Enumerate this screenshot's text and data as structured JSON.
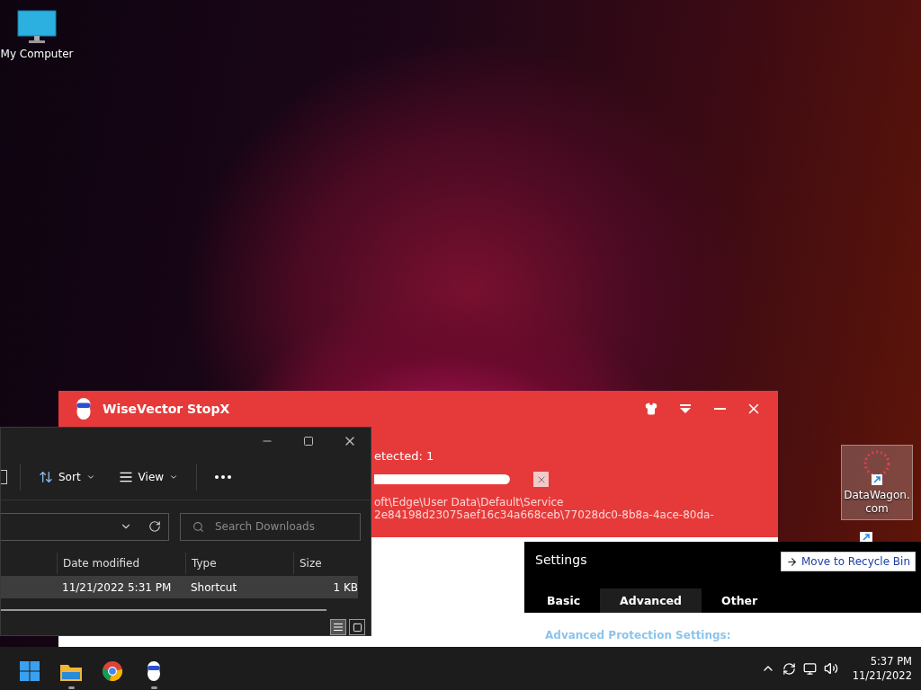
{
  "desktop_icons": [
    {
      "label": "My Computer",
      "selected": false
    },
    {
      "label": "DataWagon.com",
      "selected": true
    }
  ],
  "tooltip": {
    "text": "Move to Recycle Bin"
  },
  "stopx": {
    "title": "WiseVector StopX",
    "detected": "etected: 1",
    "progress": {
      "level": 1
    },
    "path_lines": [
      "oft\\Edge\\User Data\\Default\\Service",
      "2e84198d23075aef16c34a668ceb\\77028dc0-8b8a-4ace-80da-"
    ]
  },
  "explorer": {
    "toolbar": [
      "Sort",
      "View"
    ],
    "search": {
      "placeholder": "Search Downloads"
    },
    "columns": [
      "Date modified",
      "Type",
      "Size"
    ],
    "rows": [
      {
        "cells": [
          "11/21/2022 5:31 PM",
          "Shortcut",
          "1 KB"
        ],
        "selected": true
      }
    ]
  },
  "settings": {
    "title": "Settings",
    "tabs": [
      {
        "label": "Basic",
        "selected": false
      },
      {
        "label": "Advanced",
        "selected": true
      },
      {
        "label": "Other",
        "selected": false
      }
    ],
    "heading": "Advanced Protection Settings:"
  },
  "taskbar": {
    "apps": [
      {
        "kind": "start",
        "running": false
      },
      {
        "kind": "folder",
        "running": true
      },
      {
        "kind": "browser",
        "running": false
      },
      {
        "kind": "robot",
        "running": true
      }
    ],
    "time": "5:37 PM",
    "date": "11/21/2022"
  }
}
